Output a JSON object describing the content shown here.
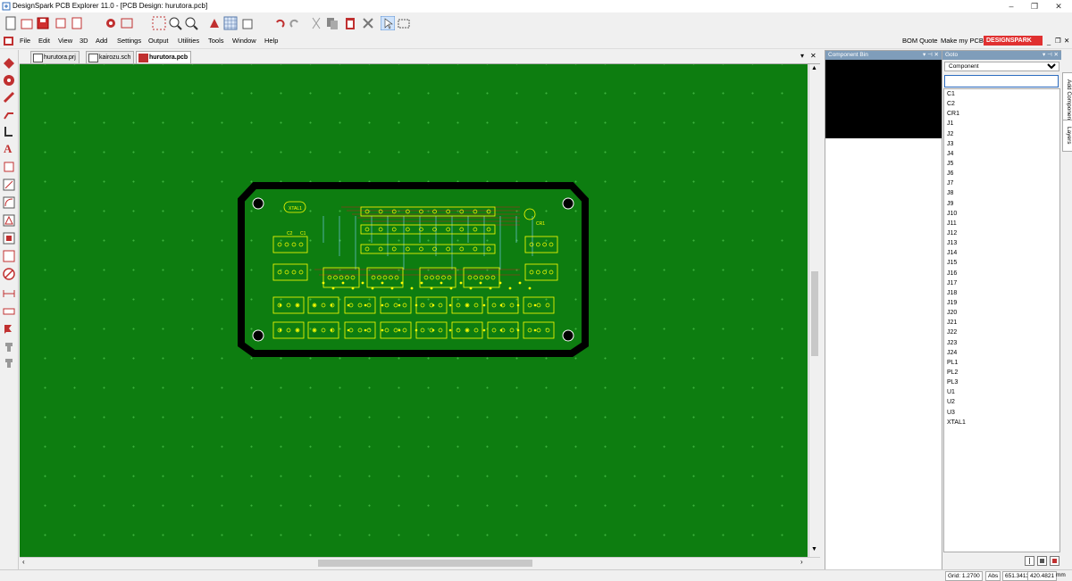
{
  "window": {
    "title": "DesignSpark PCB Explorer 11.0 - [PCB Design: hurutora.pcb]"
  },
  "menu": [
    "File",
    "Edit",
    "View",
    "3D",
    "Add",
    "Settings",
    "Output",
    "Utilities",
    "Tools",
    "Window",
    "Help"
  ],
  "menu_right": {
    "bom_quote": "BOM Quote",
    "make_my_pcb": "Make my PCB",
    "brand": "DESIGNSPARK"
  },
  "tabs": [
    {
      "label": "hurutora.prj",
      "active": false
    },
    {
      "label": "kairozu.sch",
      "active": false
    },
    {
      "label": "hurutora.pcb",
      "active": true
    }
  ],
  "colors": {
    "board": "#0d7d10",
    "copper": "#ffff00",
    "outline": "#000000",
    "trace_red": "#c02020",
    "panel_header": "#7f9dba",
    "brand_red": "#e03030"
  },
  "component_bin": {
    "title": "Component Bin"
  },
  "goto_panel": {
    "title": "Goto",
    "selected": "Component",
    "search_value": "",
    "components": [
      "C1",
      "C2",
      "CR1",
      "J1",
      "J2",
      "J3",
      "J4",
      "J5",
      "J6",
      "J7",
      "J8",
      "J9",
      "J10",
      "J11",
      "J12",
      "J13",
      "J14",
      "J15",
      "J16",
      "J17",
      "J18",
      "J19",
      "J20",
      "J21",
      "J22",
      "J23",
      "J24",
      "PL1",
      "PL2",
      "PL3",
      "U1",
      "U2",
      "U3",
      "XTAL1"
    ]
  },
  "side_tabs": {
    "add_component": "Add Component",
    "layers": "Layers"
  },
  "pcb_labels": {
    "xtal": "XTAL1",
    "c2": "C2",
    "c1": "C1",
    "cr1": "CR1"
  },
  "status": {
    "grid": "Grid: 1.2700",
    "abs_label": "Abs",
    "x": "651.3413",
    "y": "420.4821",
    "unit": "mm"
  }
}
